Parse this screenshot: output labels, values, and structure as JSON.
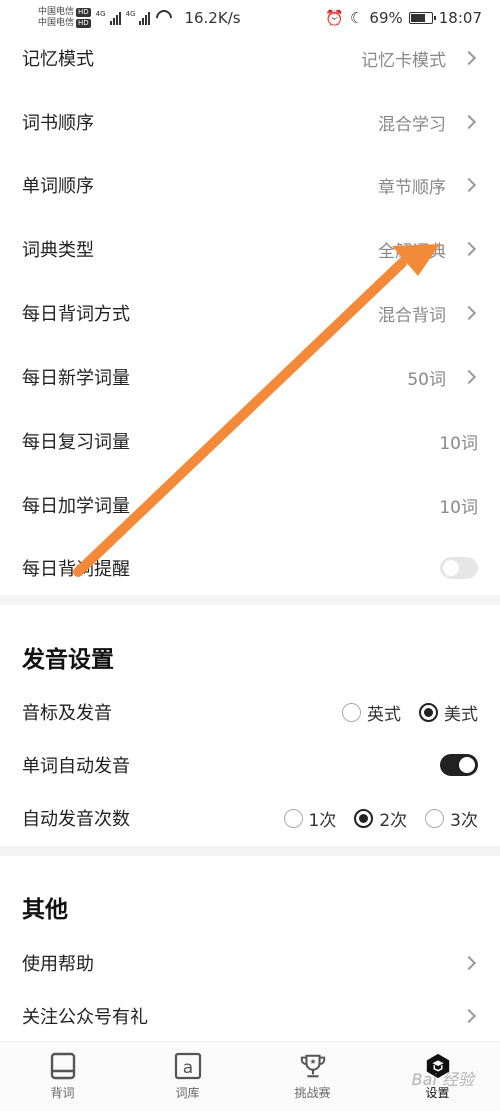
{
  "status_bar": {
    "carrier1": "中国电信",
    "carrier2": "中国电信",
    "hd": "HD",
    "net1": "4G",
    "net2": "4G",
    "speed": "16.2K/s",
    "battery": "69%",
    "battery_level": 0.69,
    "time": "18:07"
  },
  "settings": [
    {
      "label": "记忆模式",
      "value": "记忆卡模式",
      "chevron": true
    },
    {
      "label": "词书顺序",
      "value": "混合学习",
      "chevron": true
    },
    {
      "label": "单词顺序",
      "value": "章节顺序",
      "chevron": true
    },
    {
      "label": "词典类型",
      "value": "全解词典",
      "chevron": true
    },
    {
      "label": "每日背词方式",
      "value": "混合背词",
      "chevron": true
    },
    {
      "label": "每日新学词量",
      "value": "50词",
      "chevron": true
    },
    {
      "label": "每日复习词量",
      "value": "10词",
      "chevron": false
    },
    {
      "label": "每日加学词量",
      "value": "10词",
      "chevron": false
    },
    {
      "label": "每日背词提醒",
      "toggle": false
    }
  ],
  "pronunciation": {
    "title": "发音设置",
    "phonetic": {
      "label": "音标及发音",
      "options": [
        "英式",
        "美式"
      ],
      "selected": "美式"
    },
    "auto_play": {
      "label": "单词自动发音",
      "on": true
    },
    "repeat": {
      "label": "自动发音次数",
      "options": [
        "1次",
        "2次",
        "3次"
      ],
      "selected": "2次"
    }
  },
  "other": {
    "title": "其他",
    "items": [
      {
        "label": "使用帮助"
      },
      {
        "label": "关注公众号有礼"
      }
    ]
  },
  "bottom_nav": [
    {
      "label": "背词",
      "icon": "book-icon",
      "active": false
    },
    {
      "label": "词库",
      "icon": "dictionary-icon",
      "active": false
    },
    {
      "label": "挑战赛",
      "icon": "trophy-icon",
      "active": false
    },
    {
      "label": "设置",
      "icon": "settings-icon",
      "active": true
    }
  ],
  "watermark": "Bai 经验",
  "colors": {
    "accent": "#222222",
    "annotation_arrow": "#F28A3A"
  }
}
